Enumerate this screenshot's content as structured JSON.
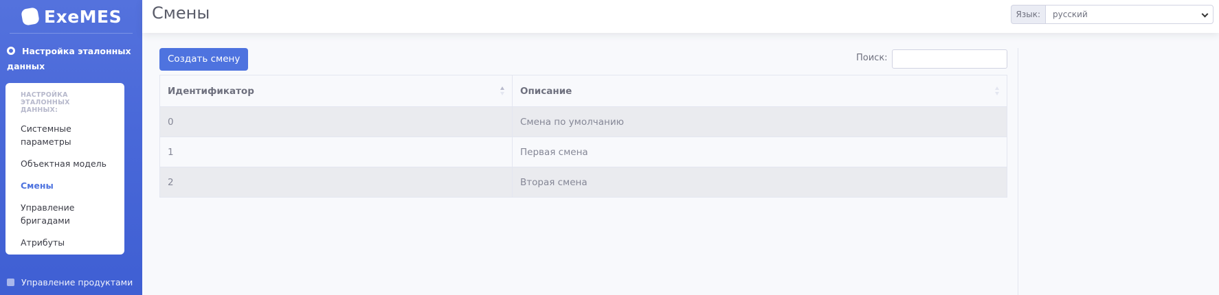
{
  "sidebar": {
    "brand": "ExeMES",
    "section_heading": "Настройка эталонных данных",
    "collapse_header": "НАСТРОЙКА ЭТАЛОННЫХ ДАННЫХ:",
    "items": [
      {
        "label": "Системные параметры"
      },
      {
        "label": "Объектная модель"
      },
      {
        "label": "Смены",
        "active": true
      },
      {
        "label": "Управление бригадами"
      },
      {
        "label": "Атрибуты"
      }
    ],
    "bottom_item": "Управление продуктами",
    "accent_color": "#4e73df"
  },
  "header": {
    "title": "Смены",
    "language_label": "Язык:",
    "language_value": "русский"
  },
  "toolbar": {
    "create_label": "Создать смену",
    "search_label": "Поиск:",
    "search_value": ""
  },
  "table": {
    "columns": [
      "Идентификатор",
      "Описание"
    ],
    "rows": [
      {
        "id": "0",
        "description": "Смена по умолчанию"
      },
      {
        "id": "1",
        "description": "Первая смена"
      },
      {
        "id": "2",
        "description": "Вторая смена"
      }
    ]
  }
}
